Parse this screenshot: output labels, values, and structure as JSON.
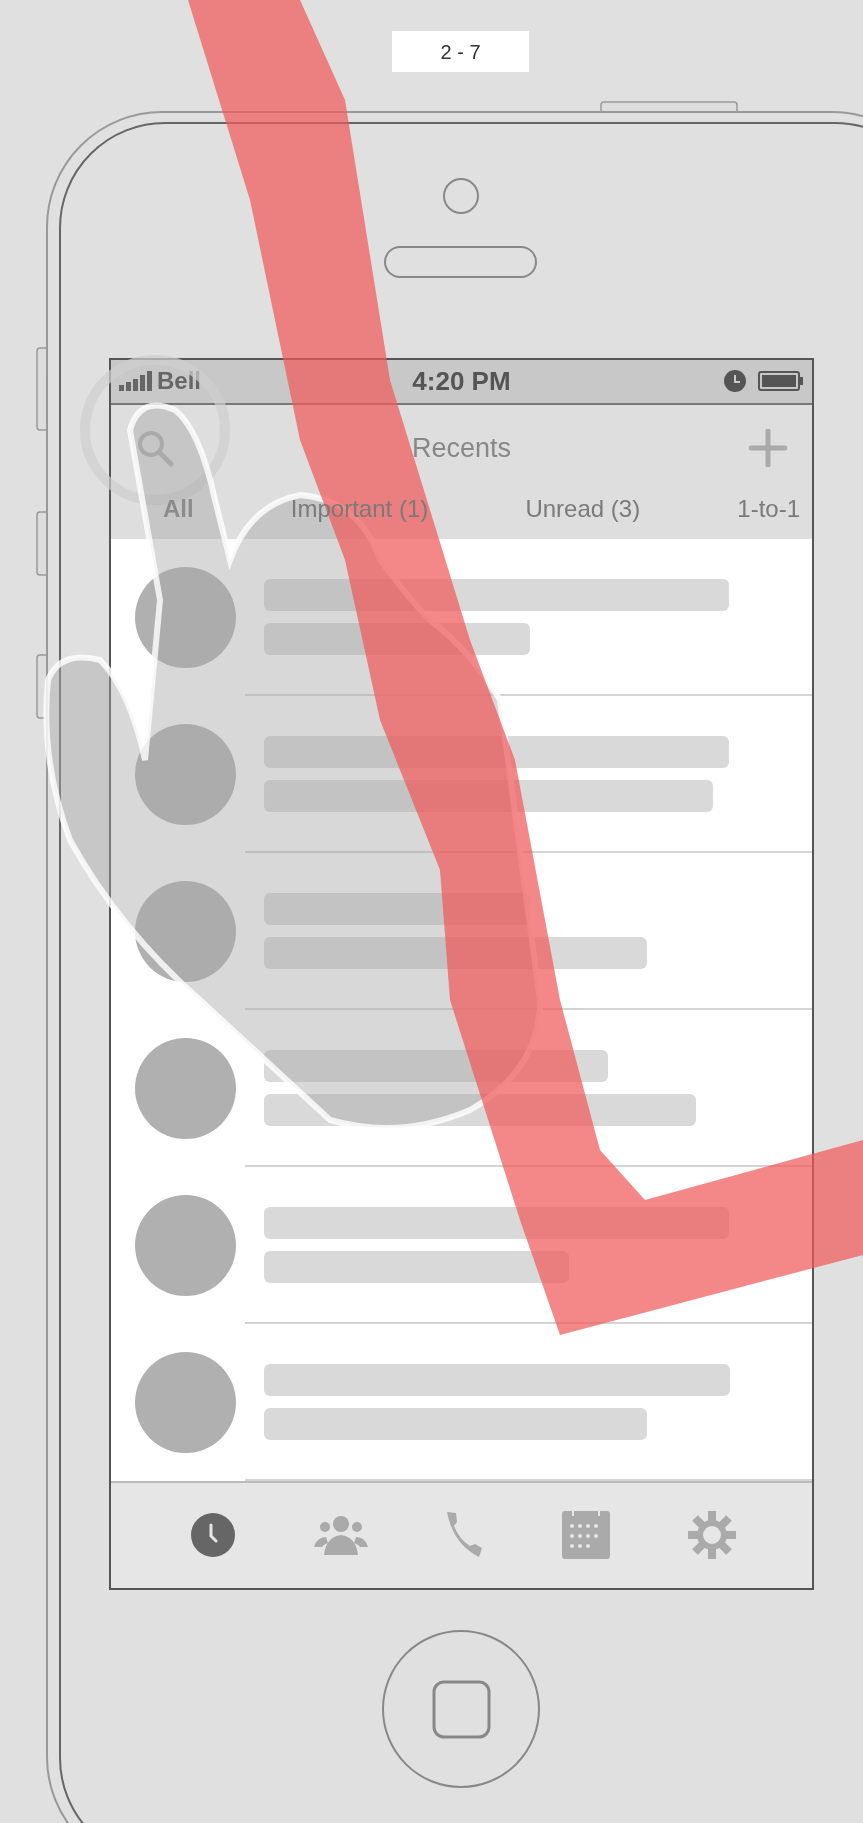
{
  "page_label": "2 - 7",
  "status_bar": {
    "carrier": "Bell",
    "time": "4:20 PM"
  },
  "header": {
    "title": "Recents"
  },
  "filter_tabs": [
    {
      "label": "All",
      "selected": true
    },
    {
      "label": "Important (1)",
      "selected": false
    },
    {
      "label": "Unread (3)",
      "selected": false
    },
    {
      "label": "1-to-1",
      "selected": false
    }
  ],
  "rows": [
    {
      "kind": "placeholder"
    },
    {
      "kind": "placeholder"
    },
    {
      "kind": "placeholder"
    },
    {
      "kind": "placeholder"
    },
    {
      "kind": "placeholder"
    },
    {
      "kind": "placeholder"
    }
  ],
  "tab_bar": [
    {
      "kind": "clock",
      "selected": true
    },
    {
      "kind": "people",
      "selected": false
    },
    {
      "kind": "phone",
      "selected": false
    },
    {
      "kind": "calendar",
      "selected": false
    },
    {
      "kind": "gear",
      "selected": false
    }
  ]
}
